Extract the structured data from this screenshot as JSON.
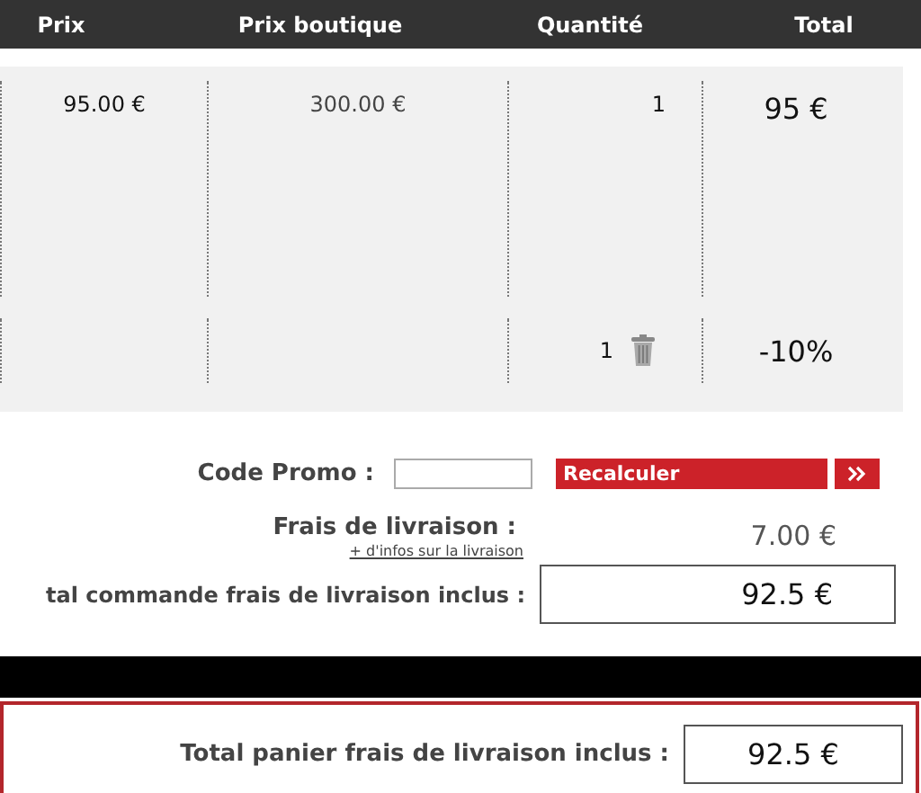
{
  "table": {
    "columns": [
      "Prix",
      "Prix boutique",
      "Quantité",
      "Total"
    ],
    "rows": [
      {
        "kind": "product",
        "price": "95.00 €",
        "shop_price": "300.00 €",
        "quantity": "1",
        "total": "95 €"
      },
      {
        "kind": "discount",
        "quantity": "1",
        "total": "-10%"
      }
    ]
  },
  "promo": {
    "label": "Code Promo :",
    "button": "Recalculer"
  },
  "shipping": {
    "label": "Frais de livraison :",
    "link": "+ d'infos sur la livraison",
    "value": "7.00 €"
  },
  "order_total": {
    "label": "tal commande frais de livraison inclus :",
    "value": "92.5 €"
  },
  "cart_total": {
    "label": "Total panier frais de livraison inclus :",
    "value": "92.5 €"
  }
}
